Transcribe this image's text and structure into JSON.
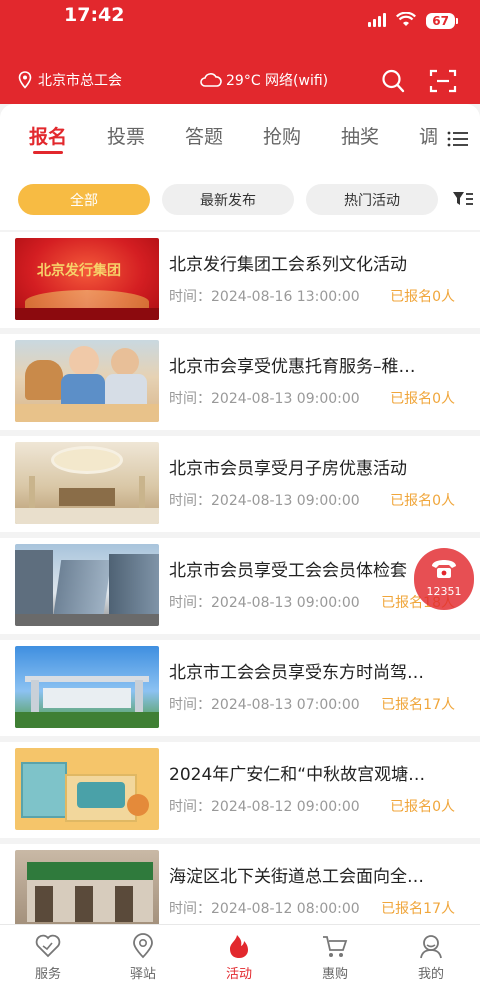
{
  "status": {
    "time": "17:42",
    "battery": "67"
  },
  "header": {
    "location": "北京市总工会",
    "weather": "29°C 网络(wifi)",
    "colors": {
      "brand": "#e2282d",
      "accent": "#f7bb43",
      "count": "#f0a63b"
    }
  },
  "tabs": [
    "报名",
    "投票",
    "答题",
    "抢购",
    "抽奖",
    "调"
  ],
  "filters": [
    "全部",
    "最新发布",
    "热门活动"
  ],
  "items": [
    {
      "title": "北京发行集团工会系列文化活动",
      "time": "时间：2024-08-16 13:00:00",
      "count": "已报名0人",
      "thumb_text": "北京发行集团"
    },
    {
      "title": "北京市会享受优惠托育服务–稚…",
      "time": "时间：2024-08-13 09:00:00",
      "count": "已报名0人"
    },
    {
      "title": "北京市会员享受月子房优惠活动",
      "time": "时间：2024-08-13 09:00:00",
      "count": "已报名0人"
    },
    {
      "title": "北京市会员享受工会会员体检套",
      "time": "时间：2024-08-13 09:00:00",
      "count": "已报名18人"
    },
    {
      "title": "北京市工会会员享受东方时尚驾…",
      "time": "时间：2024-08-13 07:00:00",
      "count": "已报名17人"
    },
    {
      "title": "2024年广安仁和“中秋故宫观塘…",
      "time": "时间：2024-08-12 09:00:00",
      "count": "已报名0人"
    },
    {
      "title": "海淀区北下关街道总工会面向全…",
      "time": "时间：2024-08-12 08:00:00",
      "count": "已报名17人"
    }
  ],
  "hotline": {
    "number": "12351"
  },
  "bottom_nav": [
    "服务",
    "驿站",
    "活动",
    "惠购",
    "我的"
  ]
}
